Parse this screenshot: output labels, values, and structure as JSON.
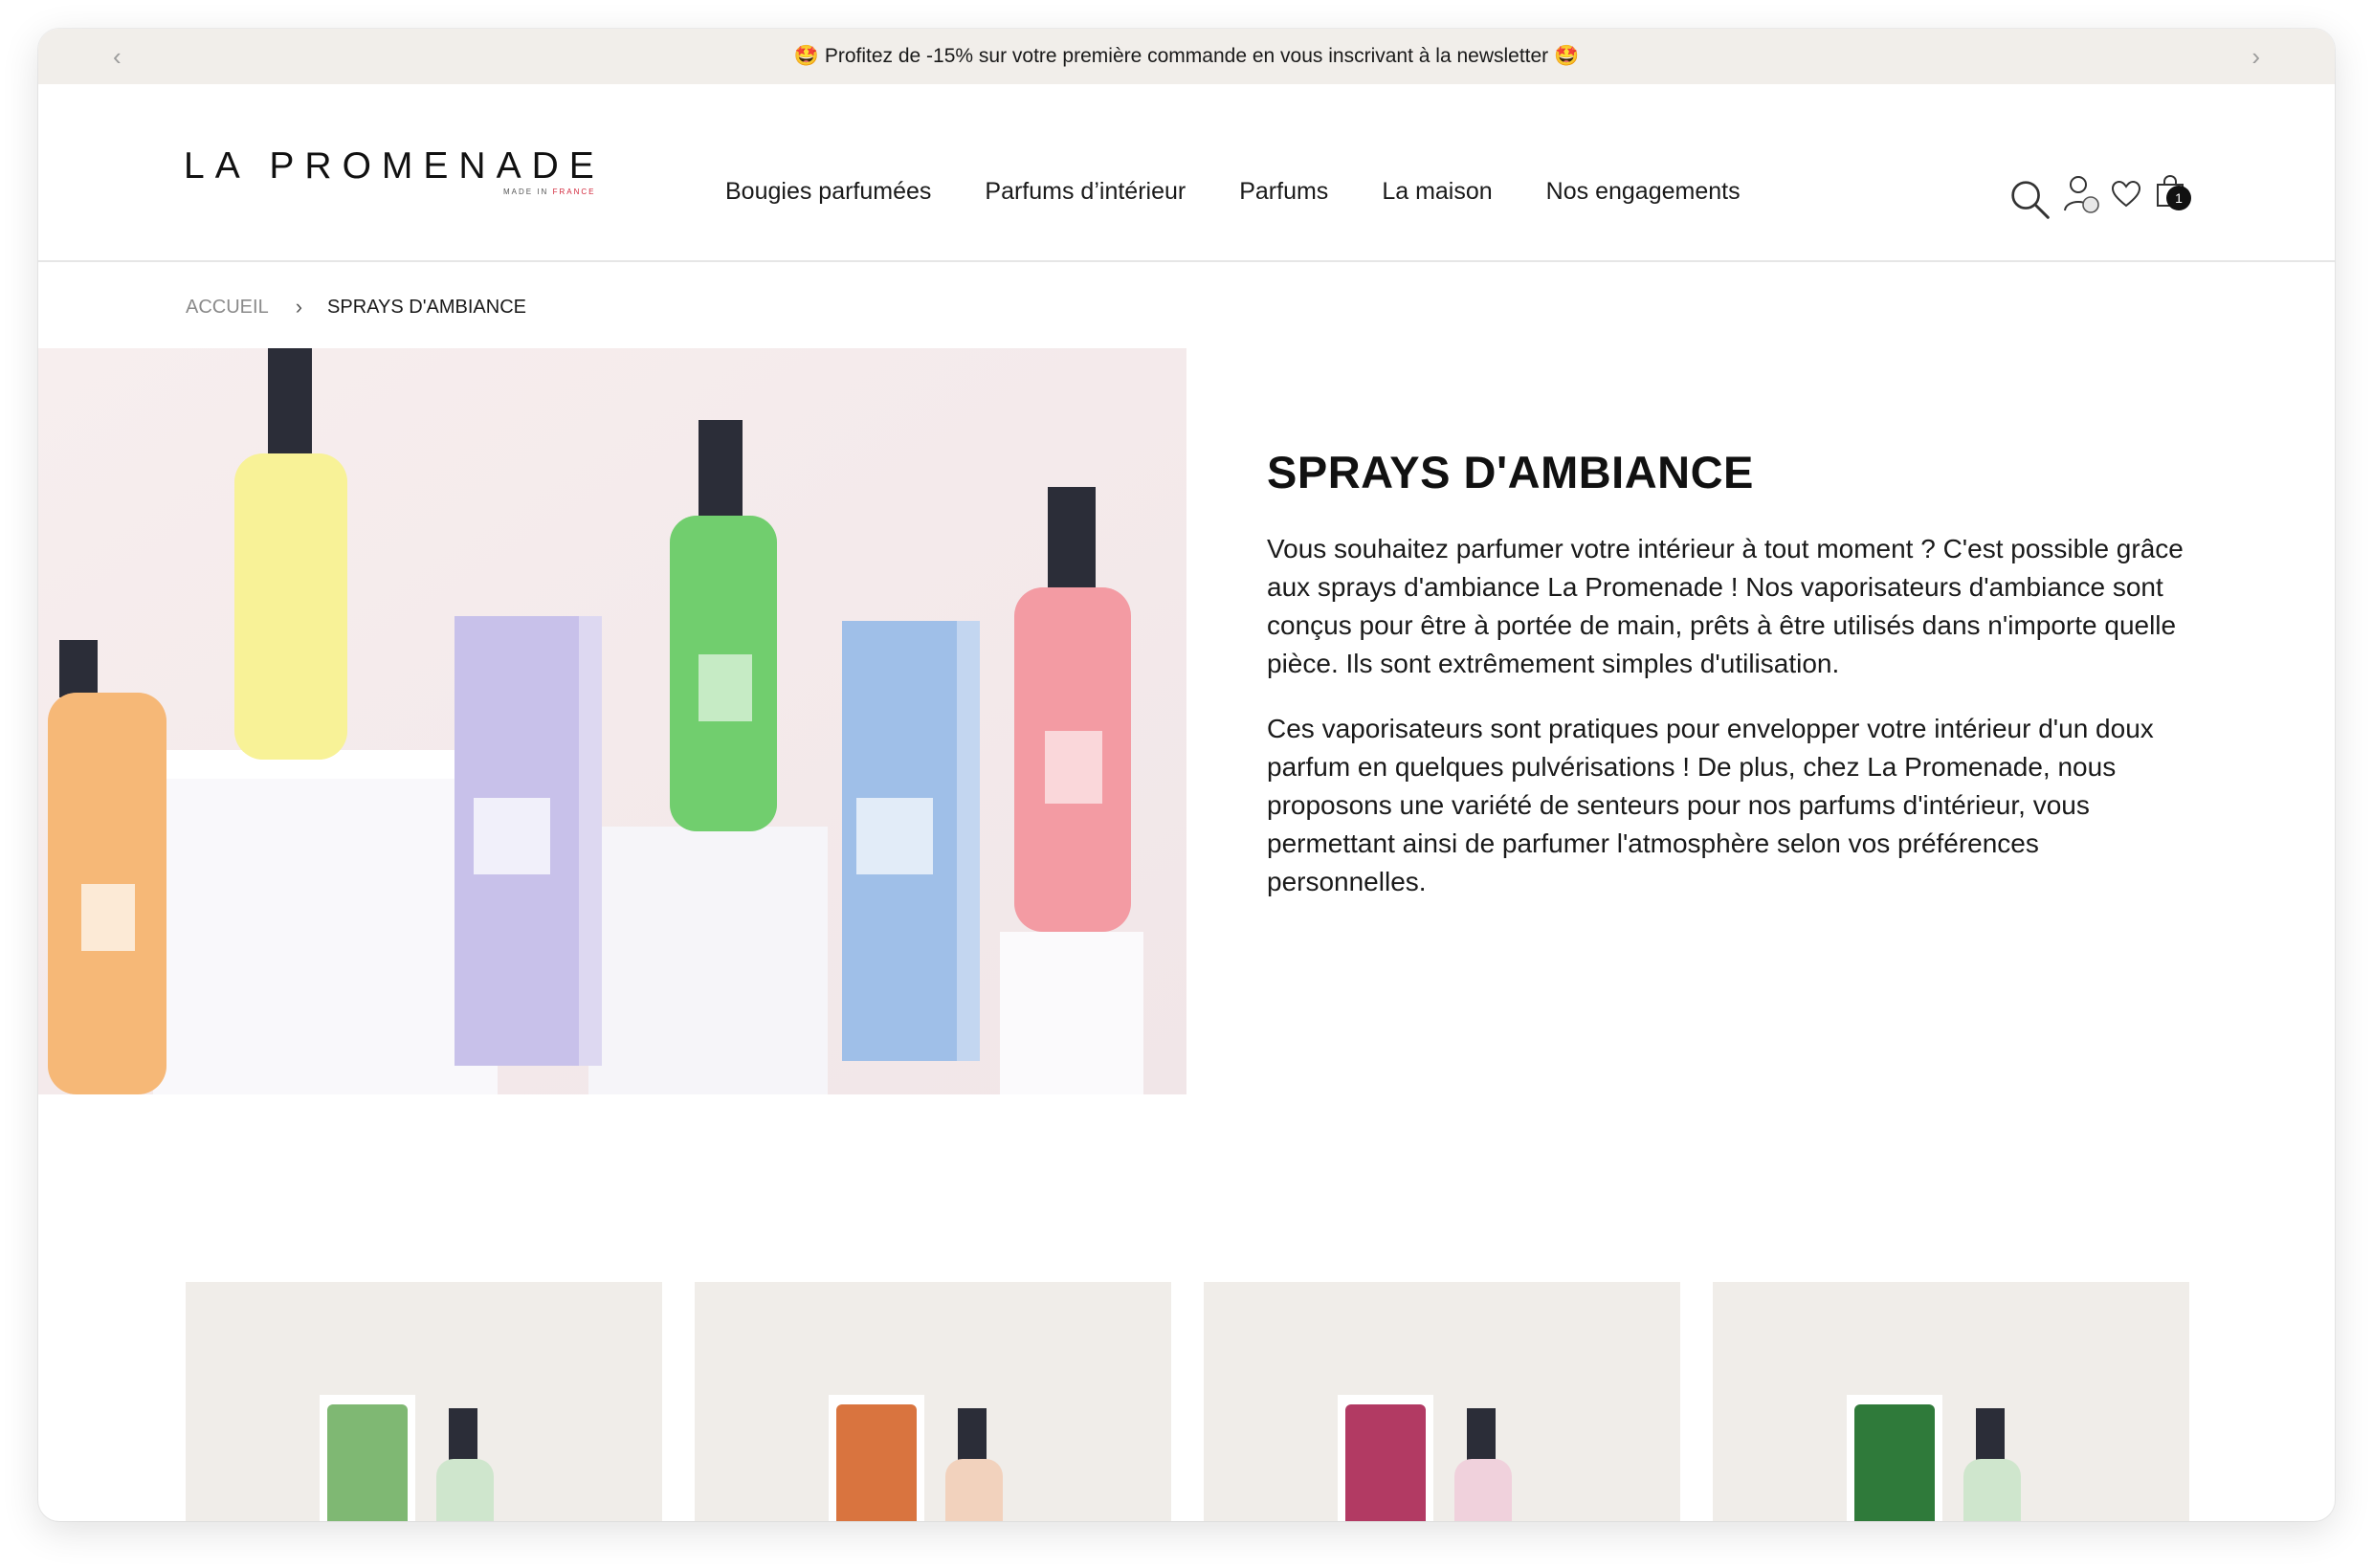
{
  "promo": {
    "text": "🤩 Profitez de -15% sur votre première commande en vous inscrivant à la newsletter 🤩",
    "prev_arrow": "‹",
    "next_arrow": "›"
  },
  "header": {
    "logo": "LA PROMENADE",
    "logo_sub_1": "MADE IN ",
    "logo_sub_2": "FRANCE",
    "nav": [
      "Bougies parfumées",
      "Parfums d’intérieur",
      "Parfums",
      "La maison",
      "Nos engagements"
    ],
    "cart_count": "1",
    "icons": [
      "search-icon",
      "account-icon",
      "wishlist-heart-icon",
      "cart-bag-icon"
    ]
  },
  "breadcrumb": {
    "home": "ACCUEIL",
    "separator": "›",
    "current": "SPRAYS D'AMBIANCE"
  },
  "hero": {
    "title": "SPRAYS D'AMBIANCE",
    "paragraph_1": "Vous souhaitez parfumer votre intérieur à tout moment ? C'est possible grâce aux sprays d'ambiance La Promenade ! Nos vaporisateurs d'ambiance sont conçus pour être à portée de main, prêts à être utilisés dans n'importe quelle pièce. Ils sont extrêmement simples d'utilisation.",
    "paragraph_2": "Ces vaporisateurs sont pratiques pour envelopper votre intérieur d'un doux parfum en quelques pulvérisations ! De plus, chez La Promenade, nous proposons une variété de senteurs pour nos parfums d'intérieur, vous permettant ainsi de parfumer l'atmosphère selon vos préférences personnelles."
  },
  "products": [
    {
      "box_color": "#7fb873",
      "bottle_tint": "#cfe6cd"
    },
    {
      "box_color": "#d9743f",
      "bottle_tint": "#f2d2bd"
    },
    {
      "box_color": "#b23a63",
      "bottle_tint": "#f0d1dc"
    },
    {
      "box_color": "#2f7a3a",
      "bottle_tint": "#cfe6cd"
    }
  ]
}
